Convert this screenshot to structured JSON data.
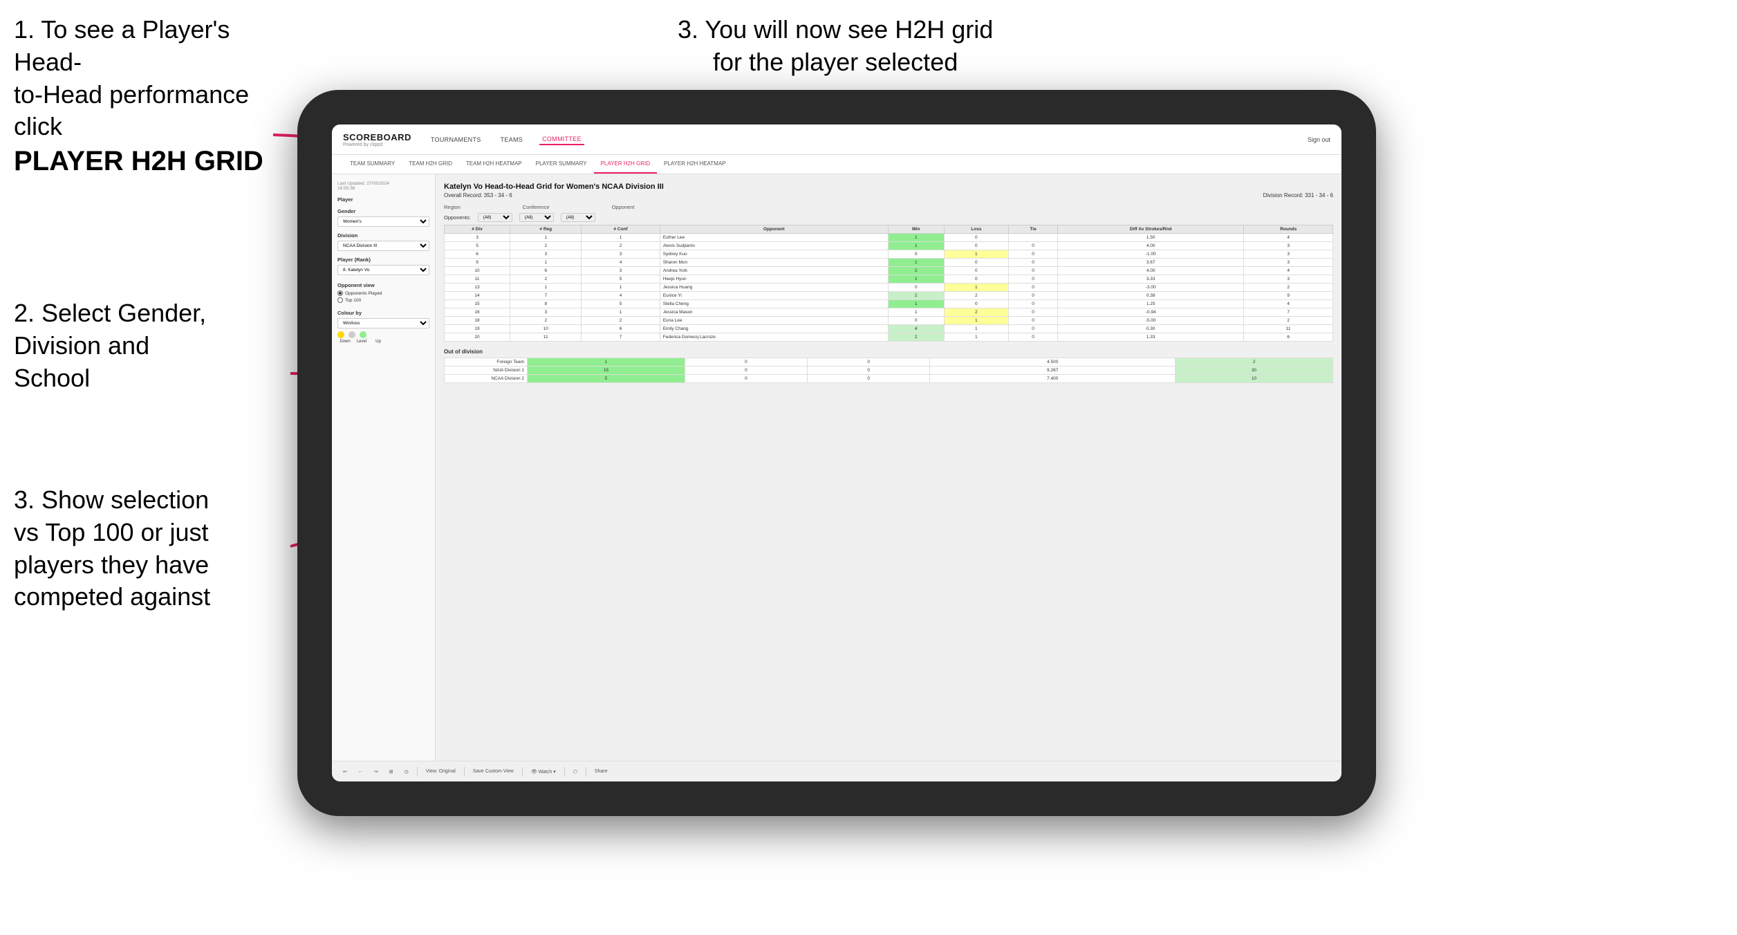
{
  "instructions": {
    "top_left_1": "1. To see a Player's Head-",
    "top_left_2": "to-Head performance click",
    "top_left_bold": "PLAYER H2H GRID",
    "top_right": "3. You will now see H2H grid\nfor the player selected",
    "mid_left_1": "2. Select Gender,",
    "mid_left_2": "Division and",
    "mid_left_3": "School",
    "bottom_left_1": "3. Show selection",
    "bottom_left_2": "vs Top 100 or just",
    "bottom_left_3": "players they have",
    "bottom_left_4": "competed against"
  },
  "nav": {
    "brand": "SCOREBOARD",
    "brand_sub": "Powered by clippd",
    "items": [
      "TOURNAMENTS",
      "TEAMS",
      "COMMITTEE"
    ],
    "right": "Sign out"
  },
  "sub_nav": {
    "items": [
      "TEAM SUMMARY",
      "TEAM H2H GRID",
      "TEAM H2H HEATMAP",
      "PLAYER SUMMARY",
      "PLAYER H2H GRID",
      "PLAYER H2H HEATMAP"
    ],
    "active": "PLAYER H2H GRID"
  },
  "sidebar": {
    "timestamp": "Last Updated: 27/03/2024\n16:55:38",
    "player_label": "Player",
    "gender_label": "Gender",
    "gender_value": "Women's",
    "division_label": "Division",
    "division_value": "NCAA Division III",
    "player_rank_label": "Player (Rank)",
    "player_rank_value": "8. Katelyn Vo",
    "opponent_view_label": "Opponent view",
    "opponent_options": [
      "Opponents Played",
      "Top 100"
    ],
    "opponent_selected": "Opponents Played",
    "colour_by_label": "Colour by",
    "colour_by_value": "Win/loss",
    "colour_labels": [
      "Down",
      "Level",
      "Up"
    ]
  },
  "main": {
    "title": "Katelyn Vo Head-to-Head Grid for Women's NCAA Division III",
    "overall_record": "Overall Record: 353 - 34 - 6",
    "division_record": "Division Record: 331 - 34 - 6",
    "region_label": "Region",
    "conference_label": "Conference",
    "opponent_label": "Opponent",
    "opponents_label": "Opponents:",
    "opponents_value": "(All)",
    "conference_value": "(All)",
    "opponent_filter_value": "(All)",
    "table_headers": [
      "# Div",
      "# Reg",
      "# Conf",
      "Opponent",
      "Win",
      "Loss",
      "Tie",
      "Diff Av Strokes/Rnd",
      "Rounds"
    ],
    "rows": [
      {
        "div": "3",
        "reg": "1",
        "conf": "1",
        "opponent": "Esther Lee",
        "win": "1",
        "loss": "0",
        "tie": "",
        "diff": "1.50",
        "rounds": "4",
        "win_color": "green",
        "loss_color": "",
        "tie_color": ""
      },
      {
        "div": "5",
        "reg": "2",
        "conf": "2",
        "opponent": "Alexis Sudjianto",
        "win": "1",
        "loss": "0",
        "tie": "0",
        "diff": "4.00",
        "rounds": "3",
        "win_color": "green",
        "loss_color": "",
        "tie_color": ""
      },
      {
        "div": "6",
        "reg": "3",
        "conf": "3",
        "opponent": "Sydney Kuo",
        "win": "0",
        "loss": "1",
        "tie": "0",
        "diff": "-1.00",
        "rounds": "3",
        "win_color": "",
        "loss_color": "yellow",
        "tie_color": ""
      },
      {
        "div": "9",
        "reg": "1",
        "conf": "4",
        "opponent": "Sharon Mun",
        "win": "1",
        "loss": "0",
        "tie": "0",
        "diff": "3.67",
        "rounds": "3",
        "win_color": "green",
        "loss_color": "",
        "tie_color": ""
      },
      {
        "div": "10",
        "reg": "6",
        "conf": "3",
        "opponent": "Andrea York",
        "win": "2",
        "loss": "0",
        "tie": "0",
        "diff": "4.00",
        "rounds": "4",
        "win_color": "green",
        "loss_color": "",
        "tie_color": ""
      },
      {
        "div": "11",
        "reg": "2",
        "conf": "5",
        "opponent": "Heejo Hyun",
        "win": "1",
        "loss": "0",
        "tie": "0",
        "diff": "3.33",
        "rounds": "3",
        "win_color": "green",
        "loss_color": "",
        "tie_color": ""
      },
      {
        "div": "13",
        "reg": "1",
        "conf": "1",
        "opponent": "Jessica Huang",
        "win": "0",
        "loss": "1",
        "tie": "0",
        "diff": "-3.00",
        "rounds": "2",
        "win_color": "",
        "loss_color": "yellow",
        "tie_color": ""
      },
      {
        "div": "14",
        "reg": "7",
        "conf": "4",
        "opponent": "Eunice Yi",
        "win": "2",
        "loss": "2",
        "tie": "0",
        "diff": "0.38",
        "rounds": "9",
        "win_color": "light-green",
        "loss_color": "",
        "tie_color": ""
      },
      {
        "div": "15",
        "reg": "8",
        "conf": "5",
        "opponent": "Stella Cheng",
        "win": "1",
        "loss": "0",
        "tie": "0",
        "diff": "1.25",
        "rounds": "4",
        "win_color": "green",
        "loss_color": "",
        "tie_color": ""
      },
      {
        "div": "16",
        "reg": "3",
        "conf": "1",
        "opponent": "Jessica Mason",
        "win": "1",
        "loss": "2",
        "tie": "0",
        "diff": "-0.94",
        "rounds": "7",
        "win_color": "",
        "loss_color": "yellow",
        "tie_color": ""
      },
      {
        "div": "18",
        "reg": "2",
        "conf": "2",
        "opponent": "Euna Lee",
        "win": "0",
        "loss": "1",
        "tie": "0",
        "diff": "-5.00",
        "rounds": "2",
        "win_color": "",
        "loss_color": "yellow",
        "tie_color": ""
      },
      {
        "div": "19",
        "reg": "10",
        "conf": "6",
        "opponent": "Emily Chang",
        "win": "4",
        "loss": "1",
        "tie": "0",
        "diff": "0.30",
        "rounds": "11",
        "win_color": "light-green",
        "loss_color": "",
        "tie_color": ""
      },
      {
        "div": "20",
        "reg": "11",
        "conf": "7",
        "opponent": "Federica Domecq Lacroze",
        "win": "2",
        "loss": "1",
        "tie": "0",
        "diff": "1.33",
        "rounds": "6",
        "win_color": "light-green",
        "loss_color": "",
        "tie_color": ""
      }
    ],
    "out_of_division_label": "Out of division",
    "out_of_division_rows": [
      {
        "name": "Foreign Team",
        "win": "1",
        "loss": "0",
        "tie": "0",
        "diff": "4.500",
        "rounds": "2"
      },
      {
        "name": "NAIA Division 1",
        "win": "15",
        "loss": "0",
        "tie": "0",
        "diff": "9.267",
        "rounds": "30"
      },
      {
        "name": "NCAA Division 2",
        "win": "5",
        "loss": "0",
        "tie": "0",
        "diff": "7.400",
        "rounds": "10"
      }
    ]
  },
  "toolbar": {
    "items": [
      "↩",
      "←",
      "↪",
      "⊞",
      "◷",
      "|",
      "View: Original",
      "|",
      "Save Custom View",
      "|",
      "👁 Watch▾",
      "|",
      "⬡",
      "|",
      "Share"
    ]
  },
  "colors": {
    "accent": "#e91e63",
    "green_cell": "#90EE90",
    "yellow_cell": "#FFFF99",
    "light_green_cell": "#c8f0c8",
    "dot_down": "#FFD700",
    "dot_level": "#cccccc",
    "dot_up": "#90EE90"
  }
}
